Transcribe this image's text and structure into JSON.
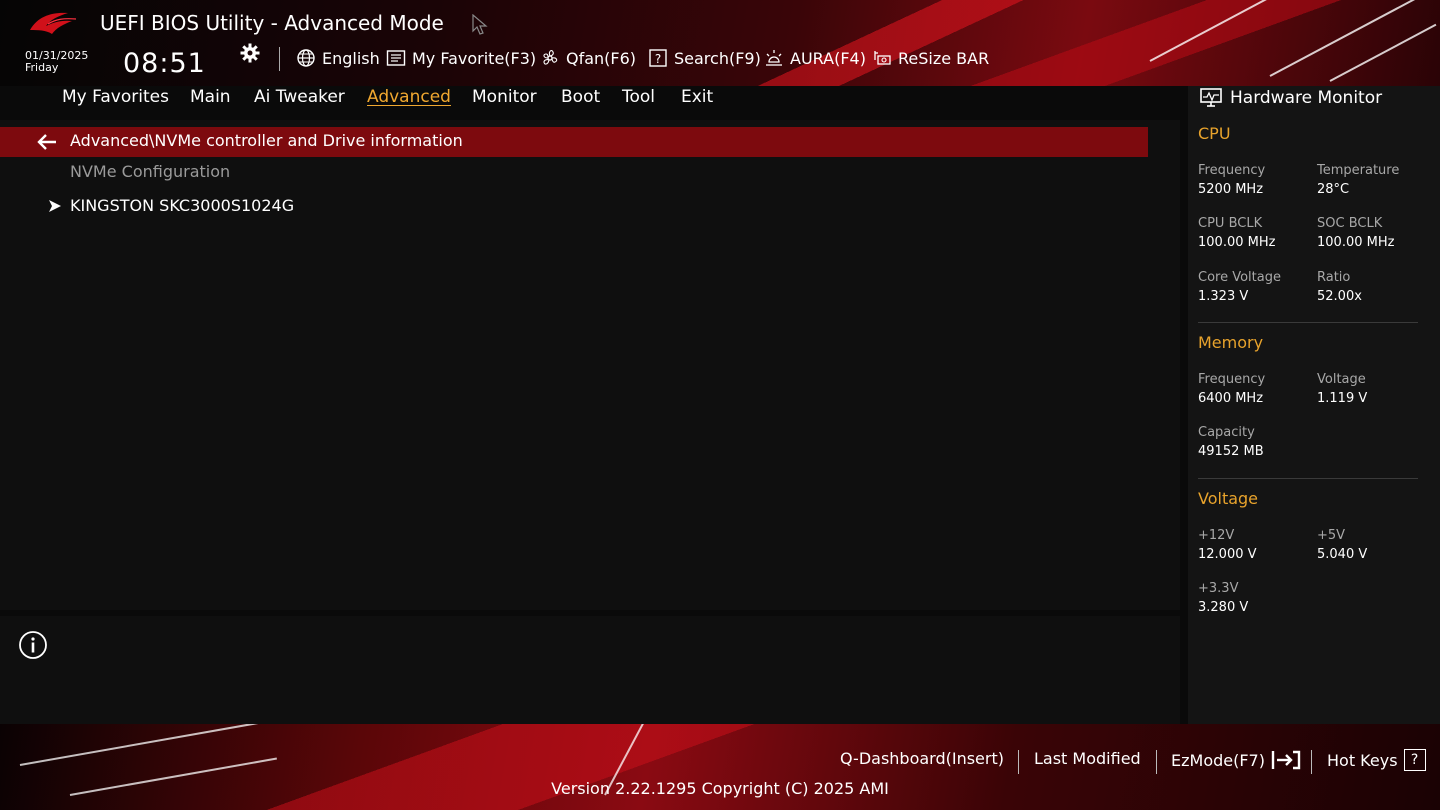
{
  "header": {
    "title": "UEFI BIOS Utility - Advanced Mode",
    "date": "01/31/2025",
    "day": "Friday",
    "time": "08:51"
  },
  "toolbar": {
    "language": "English",
    "my_favorite": "My Favorite(F3)",
    "qfan": "Qfan(F6)",
    "search": "Search(F9)",
    "aura": "AURA(F4)",
    "resize_bar": "ReSize BAR"
  },
  "tabs": [
    {
      "label": "My Favorites"
    },
    {
      "label": "Main"
    },
    {
      "label": "Ai Tweaker"
    },
    {
      "label": "Advanced"
    },
    {
      "label": "Monitor"
    },
    {
      "label": "Boot"
    },
    {
      "label": "Tool"
    },
    {
      "label": "Exit"
    }
  ],
  "active_tab": "Advanced",
  "main": {
    "breadcrumb": "Advanced\\NVMe controller and Drive information",
    "section": "NVMe Configuration",
    "items": [
      {
        "label": "KINGSTON SKC3000S1024G"
      }
    ]
  },
  "hw_monitor": {
    "title": "Hardware Monitor",
    "cpu": {
      "heading": "CPU",
      "frequency_label": "Frequency",
      "frequency": "5200 MHz",
      "temperature_label": "Temperature",
      "temperature": "28°C",
      "bclk_label": "CPU BCLK",
      "bclk": "100.00 MHz",
      "soc_bclk_label": "SOC BCLK",
      "soc_bclk": "100.00 MHz",
      "core_voltage_label": "Core Voltage",
      "core_voltage": "1.323 V",
      "ratio_label": "Ratio",
      "ratio": "52.00x"
    },
    "memory": {
      "heading": "Memory",
      "frequency_label": "Frequency",
      "frequency": "6400 MHz",
      "voltage_label": "Voltage",
      "voltage": "1.119 V",
      "capacity_label": "Capacity",
      "capacity": "49152 MB"
    },
    "voltage": {
      "heading": "Voltage",
      "v12_label": "+12V",
      "v12": "12.000 V",
      "v5_label": "+5V",
      "v5": "5.040 V",
      "v33_label": "+3.3V",
      "v33": "3.280 V"
    }
  },
  "footer": {
    "q_dashboard": "Q-Dashboard(Insert)",
    "last_modified": "Last Modified",
    "ezmode": "EzMode(F7)",
    "hot_keys": "Hot Keys",
    "hot_keys_glyph": "?",
    "version": "Version 2.22.1295 Copyright (C) 2025 AMI"
  },
  "colors": {
    "accent": "#f0a830",
    "highlight_bar": "#7d0a0e",
    "brand_red": "#d0101a"
  }
}
